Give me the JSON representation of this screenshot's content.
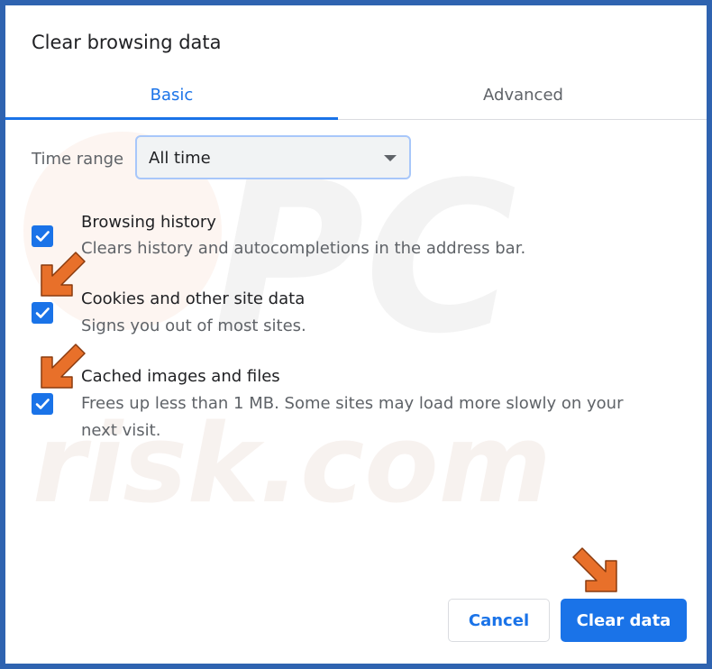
{
  "dialog": {
    "title": "Clear browsing data"
  },
  "tabs": [
    {
      "label": "Basic",
      "active": true
    },
    {
      "label": "Advanced",
      "active": false
    }
  ],
  "time_range": {
    "label": "Time range",
    "value": "All time"
  },
  "options": [
    {
      "title": "Browsing history",
      "description": "Clears history and autocompletions in the address bar.",
      "checked": true
    },
    {
      "title": "Cookies and other site data",
      "description": "Signs you out of most sites.",
      "checked": true
    },
    {
      "title": "Cached images and files",
      "description": "Frees up less than 1 MB. Some sites may load more slowly on your next visit.",
      "checked": true
    }
  ],
  "buttons": {
    "cancel": "Cancel",
    "clear": "Clear data"
  },
  "watermark": {
    "logo_text": "PC",
    "site_text": "risk.com"
  },
  "colors": {
    "accent": "#1a73e8",
    "frame_border": "#2f63b0",
    "annotation_arrow": "#e8702a"
  }
}
